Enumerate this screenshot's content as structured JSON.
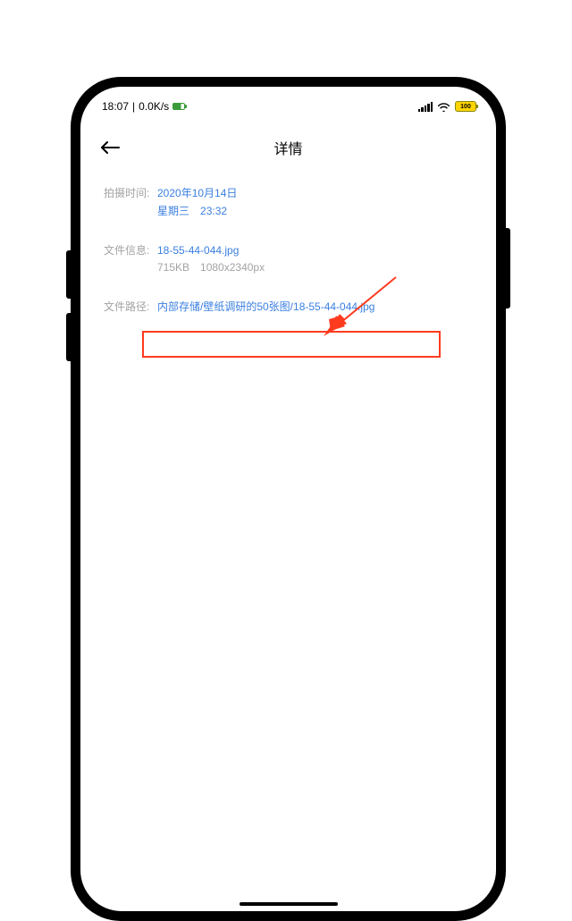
{
  "status": {
    "time": "18:07",
    "net_speed": "0.0K/s",
    "battery_text": "100"
  },
  "header": {
    "title": "详情"
  },
  "details": {
    "shot_time_label": "拍摄时间:",
    "shot_date": "2020年10月14日",
    "shot_day": "星期三",
    "shot_clock": "23:32",
    "file_info_label": "文件信息:",
    "file_name": "18-55-44-044.jpg",
    "file_size": "715KB",
    "file_dims": "1080x2340px",
    "file_path_label": "文件路径:",
    "file_path": "内部存储/壁纸调研的50张图/18-55-44-044.jpg"
  },
  "annotation": {
    "highlight_color": "#ff3b1f"
  }
}
